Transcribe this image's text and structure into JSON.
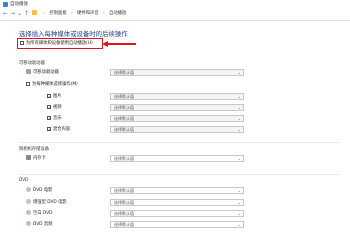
{
  "window": {
    "title": "自动播放"
  },
  "address": {
    "back_glyph": "←",
    "forward_glyph": "→",
    "down_glyph": "⌄",
    "up_glyph": "↑",
    "breadcrumbs": [
      "控制面板",
      "硬件和声音",
      "自动播放"
    ]
  },
  "heading": "选择插入每种媒体或设备时的后续操作",
  "global_option": {
    "label": "为所有媒体和设备使用自动播放(U)",
    "checked": false
  },
  "sections": {
    "removable": {
      "title": "可移动驱动器",
      "rows": {
        "drive": {
          "label": "可移动驱动器",
          "value": "选择默认值"
        },
        "per_type": {
          "label": "为每种媒体选择操作(M)",
          "checked": false
        },
        "pictures": {
          "label": "图片",
          "value": "选择默认值"
        },
        "videos": {
          "label": "视频",
          "value": "选择默认值"
        },
        "music": {
          "label": "音乐",
          "value": "选择默认值"
        },
        "mixed": {
          "label": "混合内容",
          "value": "选择默认值"
        }
      }
    },
    "camera_storage": {
      "title": "照相机存储设备",
      "rows": {
        "memory_card": {
          "label": "内存卡",
          "value": "选择默认值"
        }
      }
    },
    "dvd": {
      "title": "DVD",
      "rows": {
        "dvd_movie": {
          "label": "DVD 电影",
          "value": "选择默认值"
        },
        "enhanced_dvd": {
          "label": "增强型 DVD 电影",
          "value": "选择默认值"
        },
        "blank_dvd": {
          "label": "空白 DVD",
          "value": "选择默认值"
        },
        "dvd_audio": {
          "label": "DVD 音频",
          "value": "选择默认值"
        }
      }
    }
  },
  "dropdown_glyph": "⌄",
  "colors": {
    "accent_heading": "#1a3e8c",
    "callout_red": "#d71920"
  }
}
